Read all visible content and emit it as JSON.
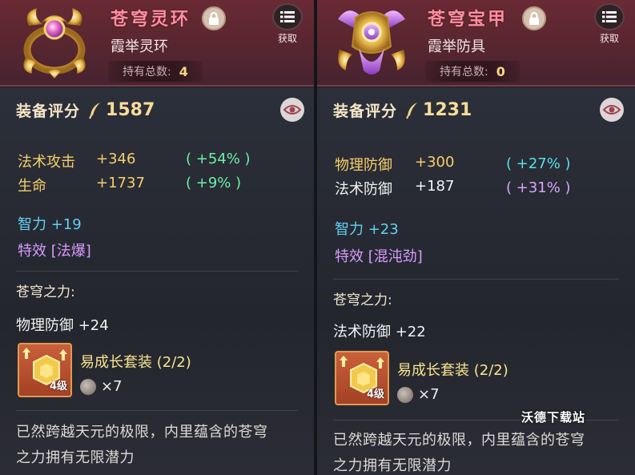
{
  "panels": [
    {
      "name": "苍穹灵环",
      "type": "霞举灵环",
      "owned_label": "持有总数:",
      "owned_value": "4",
      "get_label": "获取",
      "score_label": "装备评分",
      "score_value": "1587",
      "stats": [
        {
          "name": "法术攻击",
          "value": "+346",
          "pct": "( +54% )"
        },
        {
          "name": "生命",
          "value": "+1737",
          "pct": "( +9% )"
        }
      ],
      "attribute": "智力 +19",
      "effect": "特效 [法爆]",
      "power_title": "苍穹之力:",
      "power_stat": "物理防御 +24",
      "set_level": "4级",
      "set_name": "易成长套装 (2/2)",
      "set_count": "×7",
      "description_line1": "已然跨越天元的极限，内里蕴含的苍穹",
      "description_line2": "之力拥有无限潜力",
      "accent_color": "#ff8ea0"
    },
    {
      "name": "苍穹宝甲",
      "type": "霞举防具",
      "owned_label": "持有总数:",
      "owned_value": "0",
      "get_label": "获取",
      "score_label": "装备评分",
      "score_value": "1231",
      "stats": [
        {
          "name": "物理防御",
          "value": "+300",
          "pct": "( +27% )"
        },
        {
          "name": "法术防御",
          "value": "+187",
          "pct": "( +31% )"
        }
      ],
      "attribute": "智力 +23",
      "effect": "特效 [混沌劲]",
      "power_title": "苍穹之力:",
      "power_stat": "法术防御 +22",
      "set_level": "4级",
      "set_name": "易成长套装 (2/2)",
      "set_count": "×7",
      "description_line1": "已然跨越天元的极限，内里蕴含的苍穹",
      "description_line2": "之力拥有无限潜力",
      "accent_color": "#ff8ea0"
    }
  ],
  "watermark": "沃德下载站",
  "icons": {
    "lock": "lock-icon",
    "get": "list-icon",
    "eye": "eye-icon",
    "quill": "quill-icon",
    "coin": "coin-icon"
  }
}
